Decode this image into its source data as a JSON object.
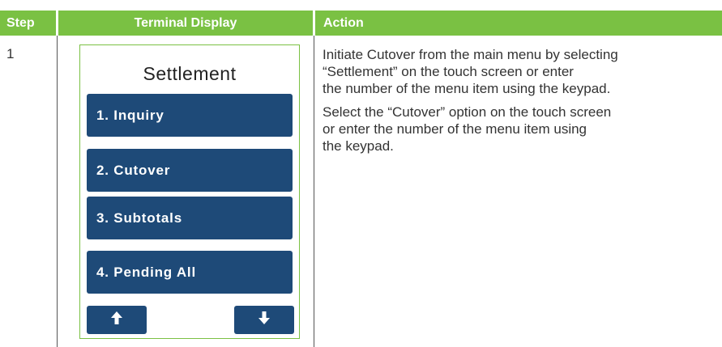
{
  "table": {
    "headers": {
      "step": "Step",
      "terminal": "Terminal Display",
      "action": "Action"
    },
    "rows": [
      {
        "step": "1",
        "terminal": {
          "title": "Settlement",
          "menu_items": [
            "1. Inquiry",
            "2. Cutover",
            "3. Subtotals",
            "4. Pending All"
          ],
          "nav_icons": [
            "up-arrow-icon",
            "down-arrow-icon"
          ]
        },
        "action": {
          "line_1": "Initiate Cutover from the main menu by selecting",
          "line_2": "“Settlement” on the touch screen or enter",
          "line_3": "the number of the menu item using the keypad.",
          "line_4": "Select the “Cutover” option on the touch screen",
          "line_5": "or enter the number of the menu item using",
          "line_6": "the keypad."
        }
      }
    ]
  },
  "colors": {
    "header_bg": "#7ac143",
    "button_bg": "#1e4a78",
    "text": "#333333"
  }
}
